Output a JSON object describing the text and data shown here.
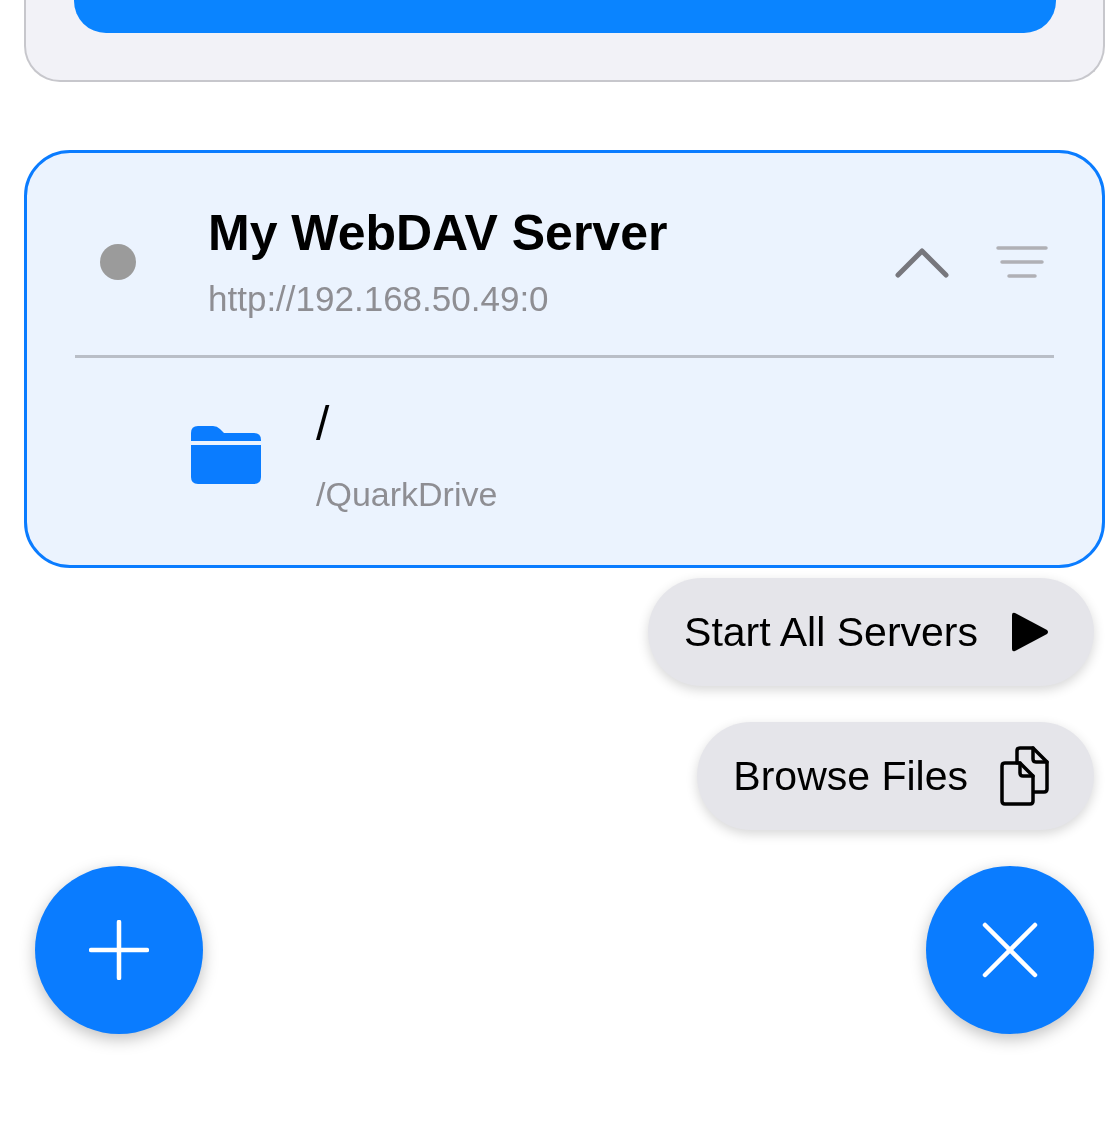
{
  "servers": [
    {
      "name": "My WebDAV Server",
      "url": "http://192.168.50.49:0",
      "running": false,
      "expanded": true,
      "selected": true,
      "folders": [
        {
          "name": "/",
          "path": "/QuarkDrive"
        }
      ]
    }
  ],
  "speed_dial": {
    "open": true,
    "actions": [
      {
        "kind": "start",
        "label": "Start All Servers"
      },
      {
        "kind": "browse",
        "label": "Browse Files"
      }
    ]
  }
}
